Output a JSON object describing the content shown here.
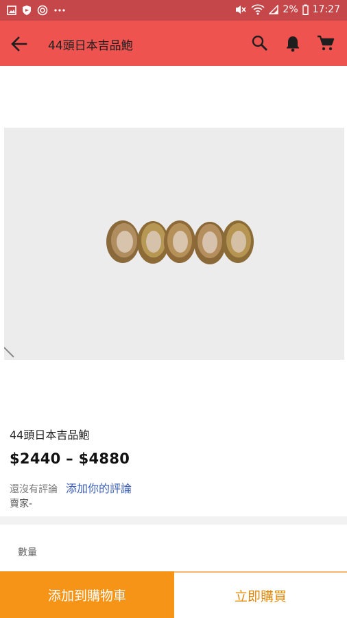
{
  "status_bar": {
    "battery": "2%",
    "time": "17:27"
  },
  "app_bar": {
    "title": "44頭日本吉品鮑"
  },
  "product": {
    "name": "44頭日本吉品鮑",
    "price_range": "$2440 – $4880",
    "no_reviews_text": "還沒有評論",
    "add_review_link": "添加你的評論",
    "seller_text": "賣家-"
  },
  "quantity": {
    "label": "數量"
  },
  "actions": {
    "add_to_cart": "添加到購物車",
    "buy_now": "立即購買"
  },
  "colors": {
    "status_bar": "#c6474a",
    "app_bar": "#ef5350",
    "cart_button": "#f59416",
    "buy_text": "#e08a0c",
    "link": "#3c5fb9"
  }
}
